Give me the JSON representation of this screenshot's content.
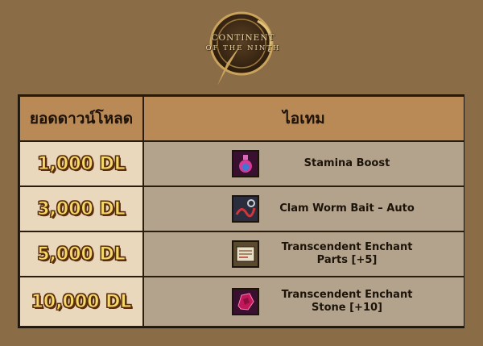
{
  "logo": {
    "line1": "CONTINENT",
    "line2": "OF THE NINTH"
  },
  "table": {
    "header": {
      "downloads": "ยอดดาวน์โหลด",
      "items": "ไอเทม"
    },
    "rows": [
      {
        "amount": "1,000 DL",
        "icon": "stamina-potion-icon",
        "name_line1": "Stamina Boost",
        "name_line2": ""
      },
      {
        "amount": "3,000 DL",
        "icon": "worm-bait-icon",
        "name_line1": "Clam Worm Bait – Auto",
        "name_line2": ""
      },
      {
        "amount": "5,000 DL",
        "icon": "enchant-parts-icon",
        "name_line1": "Transcendent Enchant",
        "name_line2": "Parts [+5]"
      },
      {
        "amount": "10,000 DL",
        "icon": "enchant-stone-icon",
        "name_line1": "Transcendent Enchant",
        "name_line2": "Stone [+10]"
      }
    ]
  },
  "colors": {
    "background": "#8a6c47",
    "header": "#b98a56",
    "amount_cell": "#ead8bd",
    "item_cell": "#b3a38d",
    "amount_text": "#f3d96a"
  }
}
